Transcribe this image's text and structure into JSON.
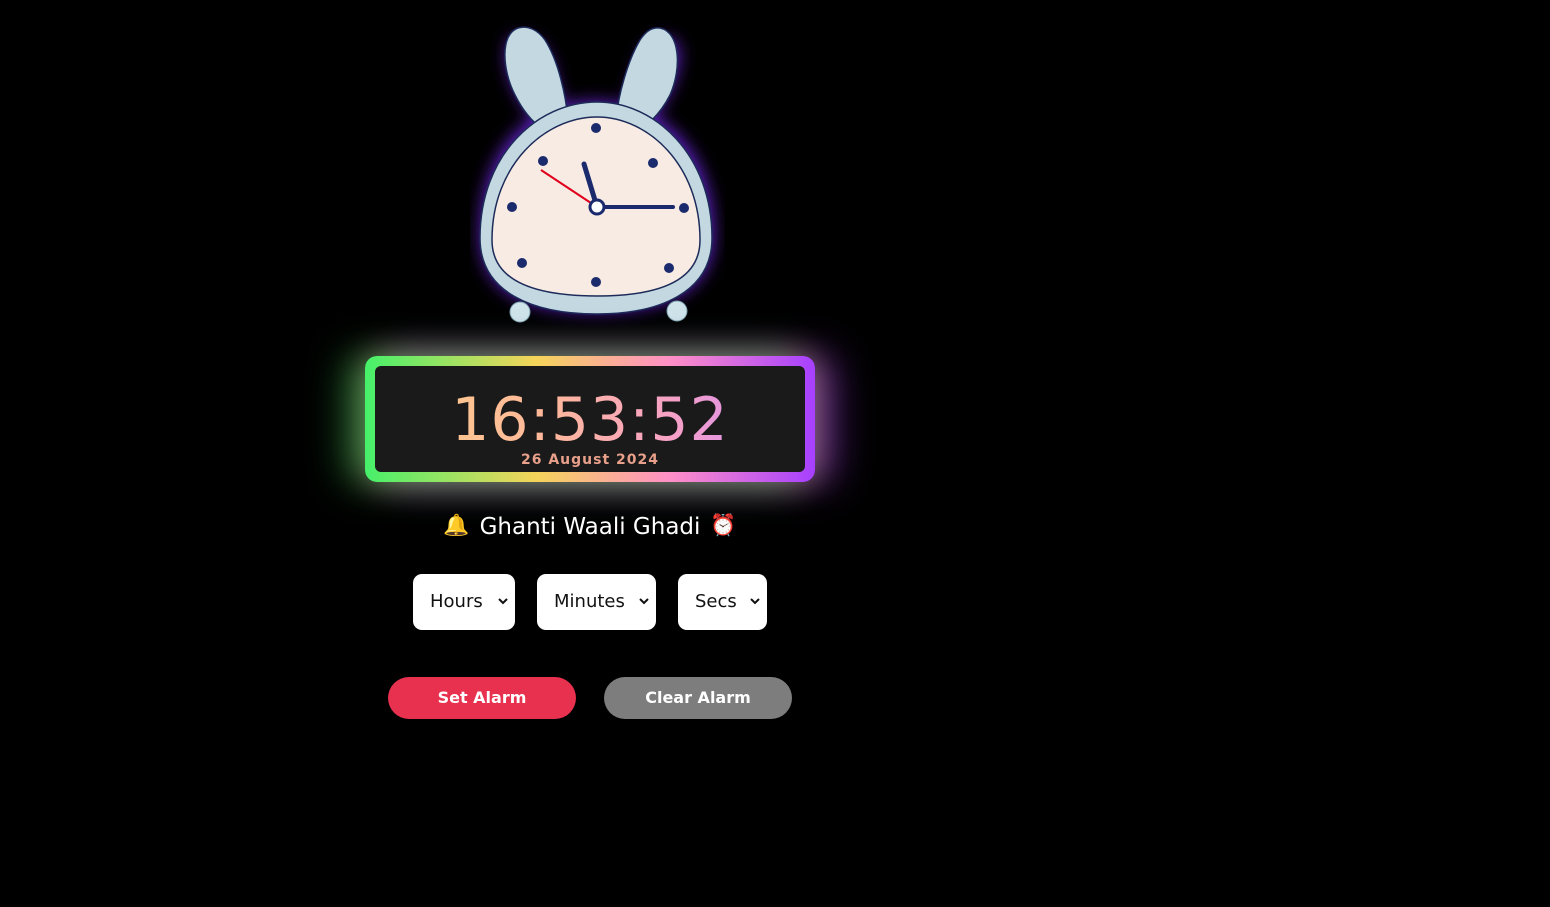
{
  "digital_clock": {
    "time": "16:53:52",
    "date": "26 August 2024"
  },
  "alarm": {
    "bell_emoji": "🔔",
    "title": "Ghanti Waali Ghadi",
    "clock_emoji": "⏰",
    "selects": {
      "hours": "Hours",
      "minutes": "Minutes",
      "secs": "Secs"
    },
    "set_button": "Set Alarm",
    "clear_button": "Clear Alarm"
  },
  "colors": {
    "background": "#000000",
    "set_button": "#e8304f",
    "clear_button": "#7d7d7d",
    "clock_body": "#c3d8e0",
    "clock_face": "#f8ebe4",
    "hands": "#1a2a6c",
    "second_hand": "#e0001b"
  }
}
